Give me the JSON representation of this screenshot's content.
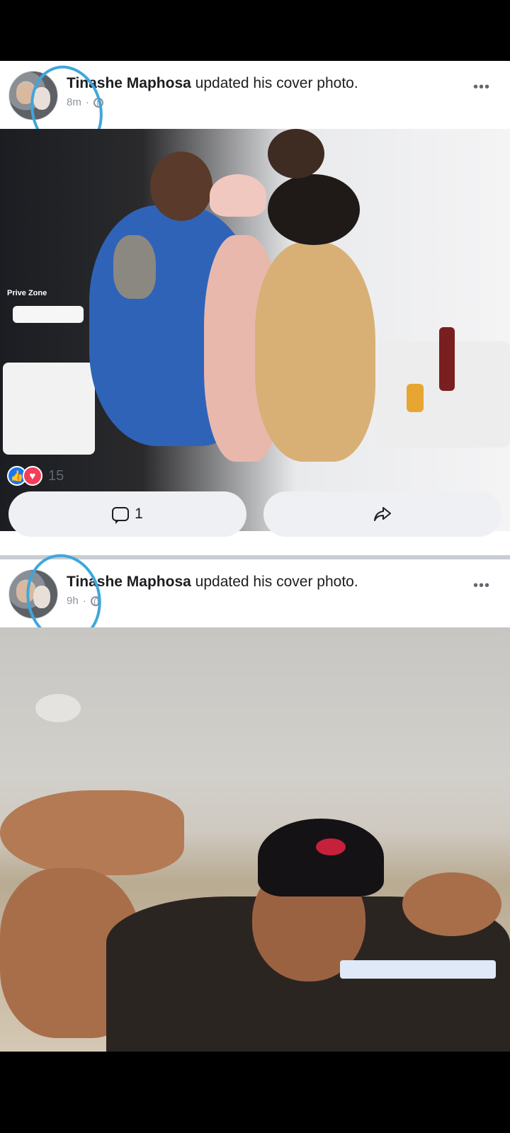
{
  "posts": [
    {
      "author": "Tinashe Maphosa",
      "action": "updated his cover photo.",
      "time": "8m",
      "more_label": "•••",
      "reactions": {
        "types": [
          "like",
          "love"
        ],
        "count": "15"
      },
      "comment_count": "1",
      "photo_watermark": "Prive Zone"
    },
    {
      "author": "Tinashe Maphosa",
      "action": "updated his cover photo.",
      "time": "9h",
      "more_label": "•••"
    }
  ],
  "icons": {
    "like": "like-icon",
    "love": "love-icon",
    "comment": "comment-icon",
    "share": "share-icon",
    "privacy": "globe-icon",
    "more": "more-icon"
  },
  "colors": {
    "brand_blue": "#1877f2",
    "love_red": "#f33e58",
    "annotation_circle": "#3fa6dc",
    "button_bg": "#eef0f3"
  }
}
